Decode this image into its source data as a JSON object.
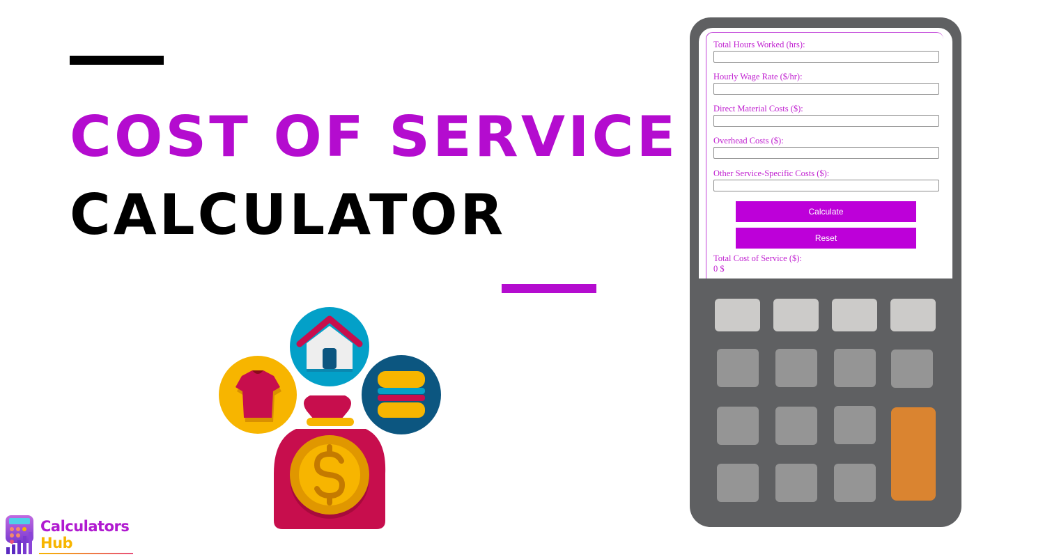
{
  "hero": {
    "title_line_1": "COST OF SERVICE",
    "title_line_2": "CALCULATOR",
    "accent_color": "#b40ccf"
  },
  "calculator": {
    "fields": [
      {
        "label": "Total Hours Worked (hrs):",
        "value": "",
        "placeholder": ""
      },
      {
        "label": "Hourly Wage Rate ($/hr):",
        "value": "",
        "placeholder": ""
      },
      {
        "label": "Direct Material Costs ($):",
        "value": "",
        "placeholder": ""
      },
      {
        "label": "Overhead Costs ($):",
        "value": "",
        "placeholder": ""
      },
      {
        "label": "Other Service-Specific Costs ($):",
        "value": "",
        "placeholder": ""
      }
    ],
    "calculate_label": "Calculate",
    "reset_label": "Reset",
    "result_label": "Total Cost of Service ($):",
    "result_value": "0 $",
    "button_color": "#bd00d9"
  },
  "illustration": {
    "icons": [
      "tshirt-icon",
      "house-icon",
      "burger-icon",
      "money-bag-icon",
      "dollar-coin-icon"
    ]
  },
  "logo": {
    "line_1": "Calculators",
    "line_2": "Hub"
  }
}
